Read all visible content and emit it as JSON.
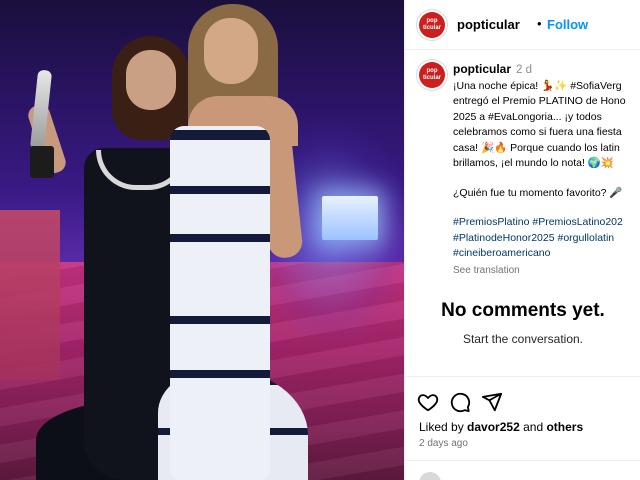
{
  "post": {
    "image_alt": "",
    "handle": "popticular",
    "follow_label": "Follow",
    "dot": "•",
    "avatar_text": [
      "pop",
      "ticular"
    ]
  },
  "caption": {
    "handle": "popticular",
    "time": "2 d",
    "lines": [
      "¡Una noche épica! 💃✨ #SofiaVerg",
      "entregó el Premio PLATINO de Hono",
      "2025 a #EvaLongoria... ¡y todos",
      "celebramos como si fuera una fiesta",
      "casa! 🎉🔥 Porque cuando los latin",
      "brillamos, ¡el mundo lo nota! 🌍💥"
    ],
    "question": "¿Quién fue tu momento favorito? 🎤",
    "hashtags": [
      "#PremiosPlatino #PremiosLatino202",
      "#PlatinodeHonor2025 #orgullolatin",
      "#cineiberoamericano"
    ],
    "see_translation": "See translation"
  },
  "comments": {
    "empty_title": "No comments yet.",
    "empty_subtitle": "Start the conversation."
  },
  "actions": {
    "icons": [
      "heart-icon",
      "comment-icon",
      "share-icon"
    ]
  },
  "likes": {
    "prefix": "Liked by",
    "user": "davor252",
    "middle": "and",
    "others": "others"
  },
  "posted_ago": "2 days ago",
  "colors": {
    "accent": "#0095f6",
    "link": "#00376b",
    "muted": "#737373",
    "avatar_bg": "#cc1f1f"
  }
}
